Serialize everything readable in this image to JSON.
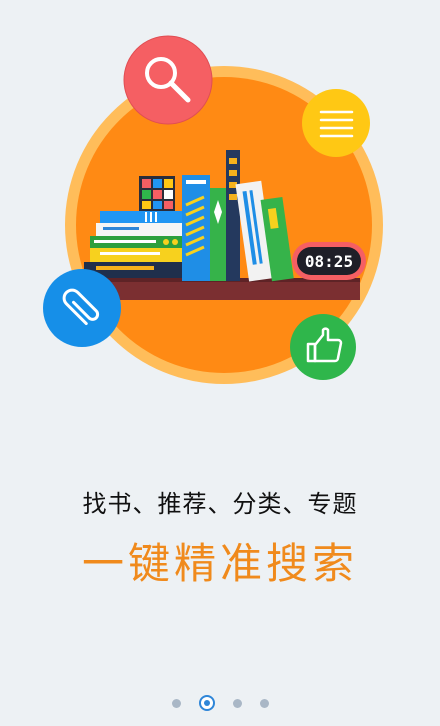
{
  "onboarding": {
    "subtitle": "找书、推荐、分类、专题",
    "headline": "一键精准搜索",
    "clock_display": "08:25",
    "page_indicator": {
      "total": 4,
      "active_index": 1
    }
  },
  "colors": {
    "background": "#edf1f4",
    "accent_orange": "#f08a1c",
    "circle_orange": "#ff8a14",
    "search_badge": "#f55f63",
    "menu_badge": "#ffc814",
    "clip_badge": "#168fe8",
    "like_badge": "#2fb64b",
    "dot_active": "#2f86d8",
    "dot_inactive": "#a9b7c6"
  },
  "icons": {
    "search": "search-icon",
    "menu": "menu-icon",
    "clip": "paperclip-icon",
    "like": "thumbs-up-icon"
  }
}
